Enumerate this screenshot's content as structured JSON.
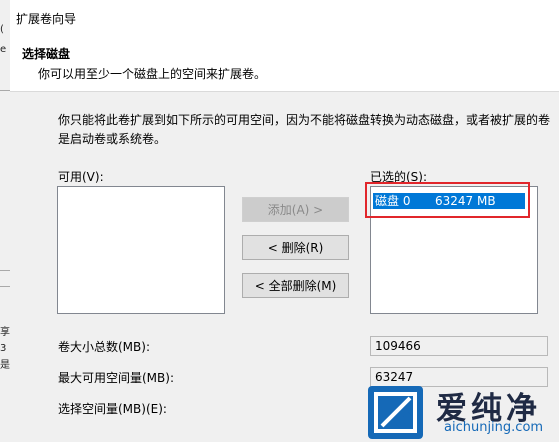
{
  "window": {
    "title": "扩展卷向导"
  },
  "header": {
    "heading": "选择磁盘",
    "subheading": "你可以用至少一个磁盘上的空间来扩展卷。"
  },
  "description": "你只能将此卷扩展到如下所示的可用空间，因为不能将磁盘转换为动态磁盘，或者被扩展的卷是启动卷或系统卷。",
  "available": {
    "label": "可用(V):",
    "items": []
  },
  "buttons": {
    "add": "添加(A) >",
    "remove": "< 删除(R)",
    "remove_all": "< 全部删除(M)"
  },
  "selected": {
    "label": "已选的(S):",
    "items": [
      {
        "disk": "磁盘 0",
        "size": "63247 MB"
      }
    ]
  },
  "fields": {
    "total_size_label": "卷大小总数(MB):",
    "total_size_value": "109466",
    "max_available_label": "最大可用空间量(MB):",
    "max_available_value": "63247",
    "select_amount_label": "选择空间量(MB)(E):"
  },
  "background_window": {
    "fragments": [
      "(",
      "e",
      "享",
      "3",
      "是"
    ]
  },
  "watermark": {
    "text": "爱纯净",
    "url": "aichunjing.com"
  },
  "colors": {
    "selection": "#0078d7",
    "highlight": "#e1262b",
    "logo": "#1569b7"
  }
}
